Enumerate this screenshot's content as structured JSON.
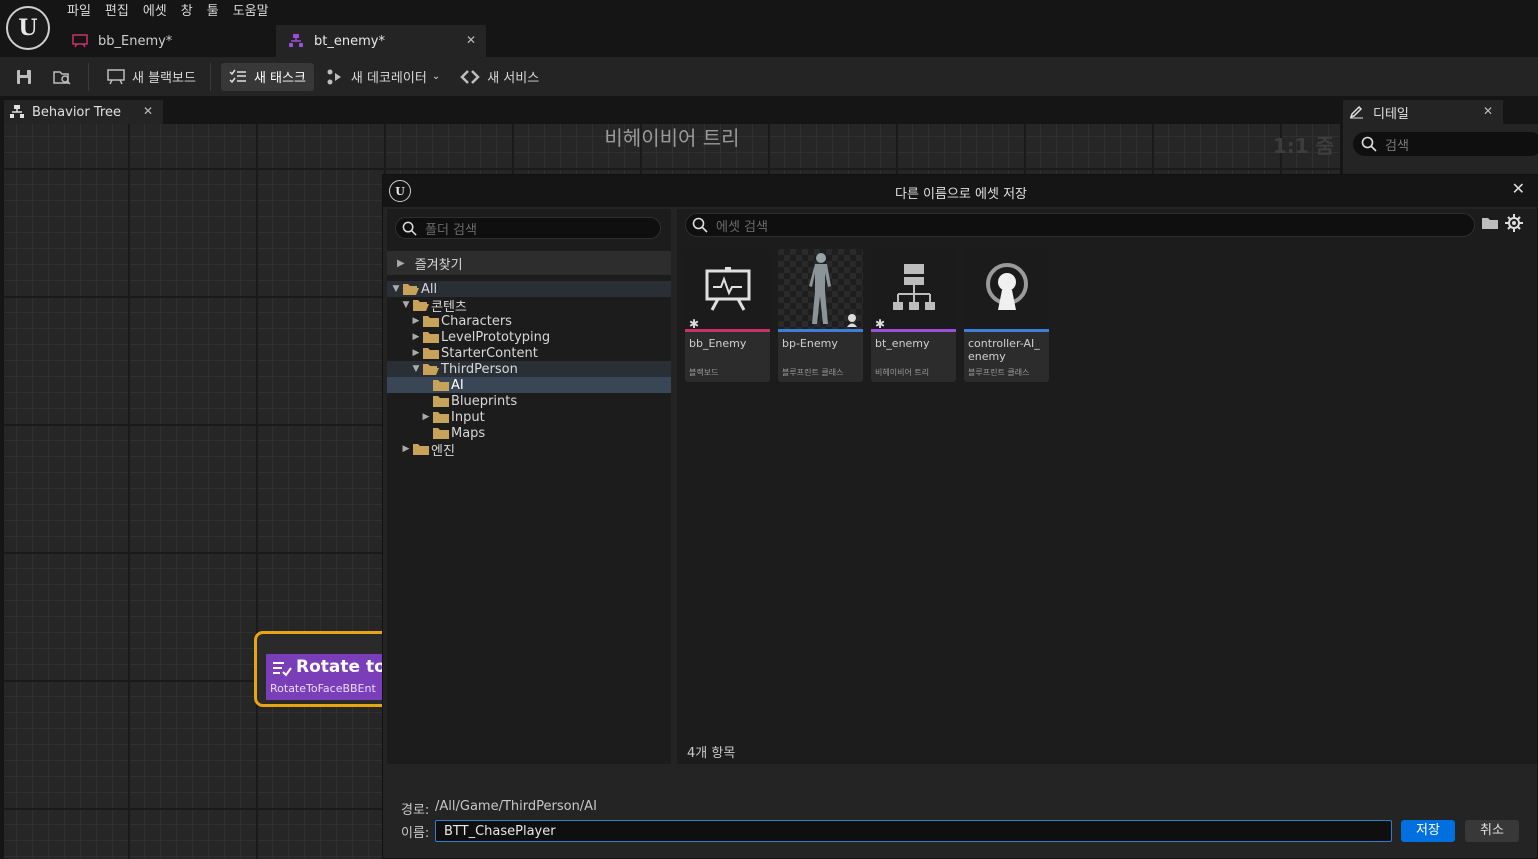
{
  "menu": [
    "파일",
    "편집",
    "에셋",
    "창",
    "툴",
    "도움말"
  ],
  "doc_tabs": [
    {
      "label": "bb_Enemy*",
      "icon": "blackboard-icon"
    },
    {
      "label": "bt_enemy*",
      "icon": "behavior-tree-icon"
    }
  ],
  "toolbar": {
    "new_blackboard": "새 블랙보드",
    "new_task": "새 태스크",
    "new_decorator": "새 데코레이터",
    "new_service": "새 서비스"
  },
  "bt_tab": {
    "label": "Behavior Tree"
  },
  "graph": {
    "title": "비헤이비어 트리",
    "zoom": "1:1 줌"
  },
  "node": {
    "title": "Rotate to",
    "subtitle": "RotateToFaceBBEnt"
  },
  "details": {
    "tab_label": "디테일",
    "search_placeholder": "검색"
  },
  "dialog": {
    "title": "다른 이름으로 에셋 저장",
    "folder_search_placeholder": "폴더 검색",
    "favorites": "즐겨찾기",
    "tree": [
      {
        "label": "All",
        "depth": 0,
        "expanded": true
      },
      {
        "label": "콘텐츠",
        "depth": 1,
        "expanded": true
      },
      {
        "label": "Characters",
        "depth": 2,
        "expanded": false
      },
      {
        "label": "LevelPrototyping",
        "depth": 2,
        "expanded": false
      },
      {
        "label": "StarterContent",
        "depth": 2,
        "expanded": false
      },
      {
        "label": "ThirdPerson",
        "depth": 2,
        "expanded": true
      },
      {
        "label": "AI",
        "depth": 3,
        "selected": true
      },
      {
        "label": "Blueprints",
        "depth": 3
      },
      {
        "label": "Input",
        "depth": 3,
        "expanded": false
      },
      {
        "label": "Maps",
        "depth": 3
      },
      {
        "label": "엔진",
        "depth": 1,
        "expanded": false
      }
    ],
    "asset_search_placeholder": "에셋 검색",
    "assets": [
      {
        "name": "bb_Enemy",
        "type": "블랙보드",
        "color": "#c8336b",
        "icon": "blackboard-icon"
      },
      {
        "name": "bp-Enemy",
        "type": "블루프린트 클래스",
        "color": "#3d7fd8",
        "icon": "character-icon"
      },
      {
        "name": "bt_enemy",
        "type": "비헤이비어 트리",
        "color": "#9b4fd8",
        "icon": "behavior-tree-icon"
      },
      {
        "name": "controller-AI_ enemy",
        "type": "블루프린트 클래스",
        "color": "#3d7fd8",
        "icon": "ai-controller-icon"
      }
    ],
    "item_count": "4개 항목",
    "path_label": "경로:",
    "path_value": "/All/Game/ThirdPerson/AI",
    "name_label": "이름:",
    "name_value": "BTT_ChasePlayer",
    "save_label": "저장",
    "cancel_label": "취소"
  }
}
